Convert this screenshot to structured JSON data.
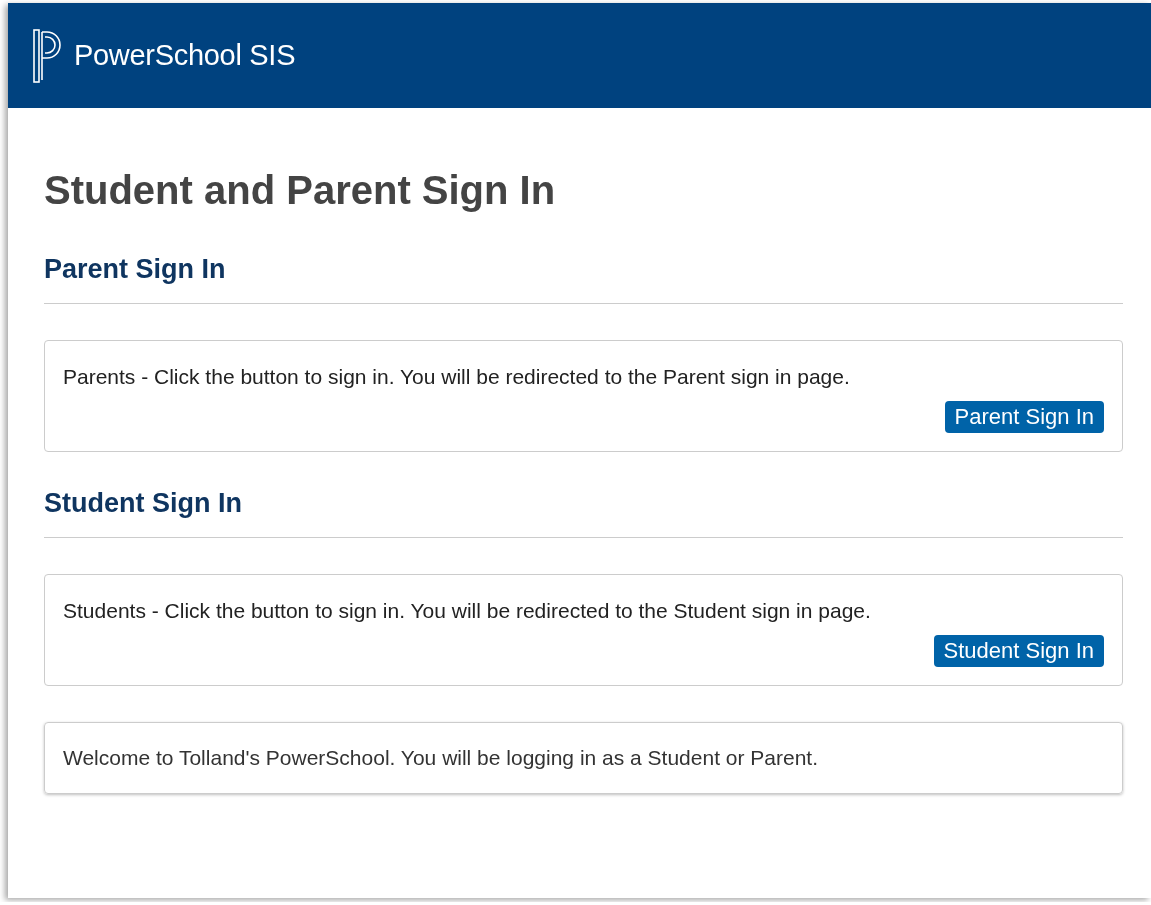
{
  "header": {
    "app_name": "PowerSchool SIS"
  },
  "title": "Student and Parent Sign In",
  "sections": [
    {
      "heading": "Parent Sign In",
      "text": "Parents - Click the button to sign in. You will be redirected to the Parent sign in page.",
      "button": "Parent Sign In"
    },
    {
      "heading": "Student Sign In",
      "text": "Students - Click the button to sign in. You will be redirected to the Student sign in page.",
      "button": "Student Sign In"
    }
  ],
  "welcome": "Welcome to Tolland's PowerSchool. You will be logging in as a Student or Parent."
}
